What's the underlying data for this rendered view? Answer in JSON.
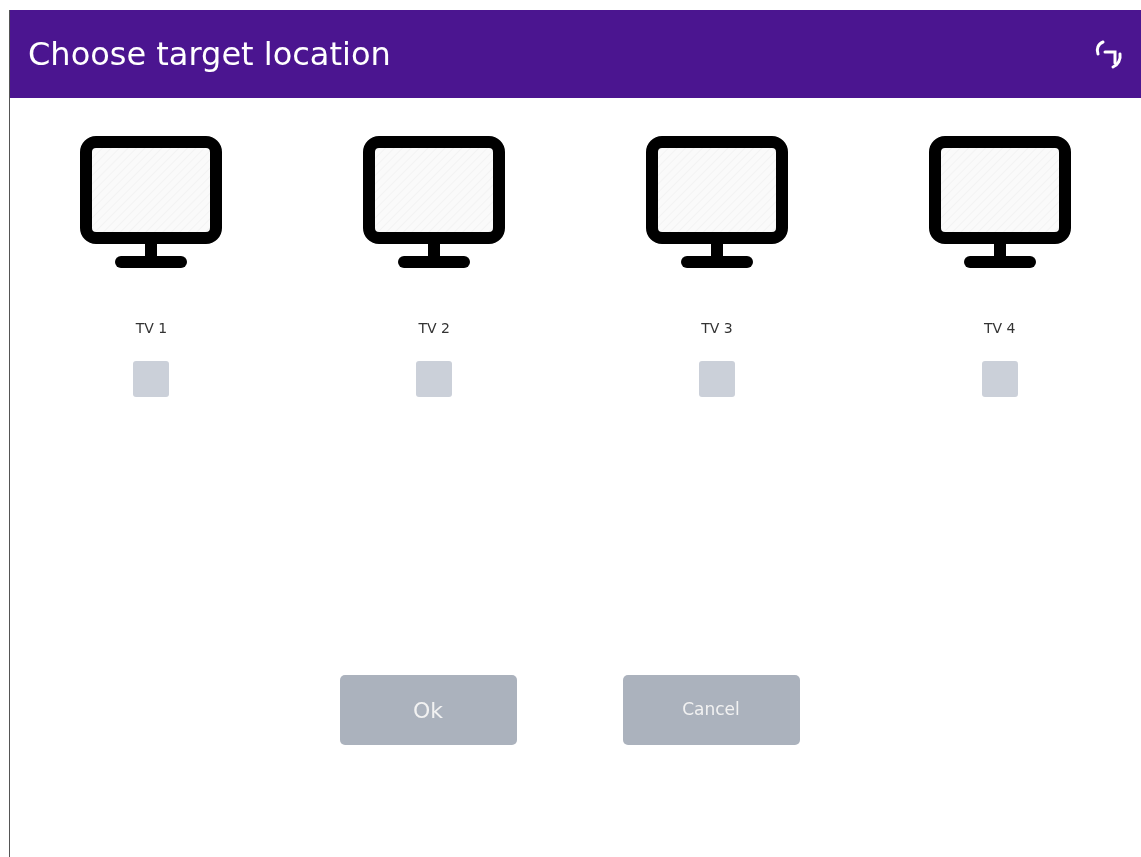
{
  "window": {
    "title": "Choose target location"
  },
  "targets": [
    {
      "label": "TV 1",
      "checked": false
    },
    {
      "label": "TV 2",
      "checked": false
    },
    {
      "label": "TV 3",
      "checked": false
    },
    {
      "label": "TV 4",
      "checked": false
    }
  ],
  "buttons": [
    {
      "label": "Ok",
      "disabled": true,
      "kind": "ok"
    },
    {
      "label": "Cancel",
      "disabled": true,
      "kind": "cancel"
    }
  ]
}
